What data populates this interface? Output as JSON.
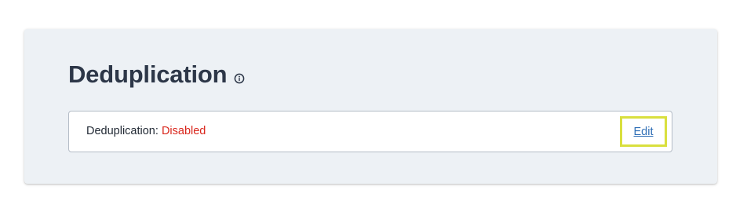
{
  "section": {
    "title": "Deduplication",
    "info_icon": "info-circle-icon"
  },
  "status": {
    "label": "Deduplication:",
    "value": "Disabled",
    "value_color": "#d9261c"
  },
  "actions": {
    "edit_label": "Edit",
    "highlight_color": "#d9df3e"
  }
}
